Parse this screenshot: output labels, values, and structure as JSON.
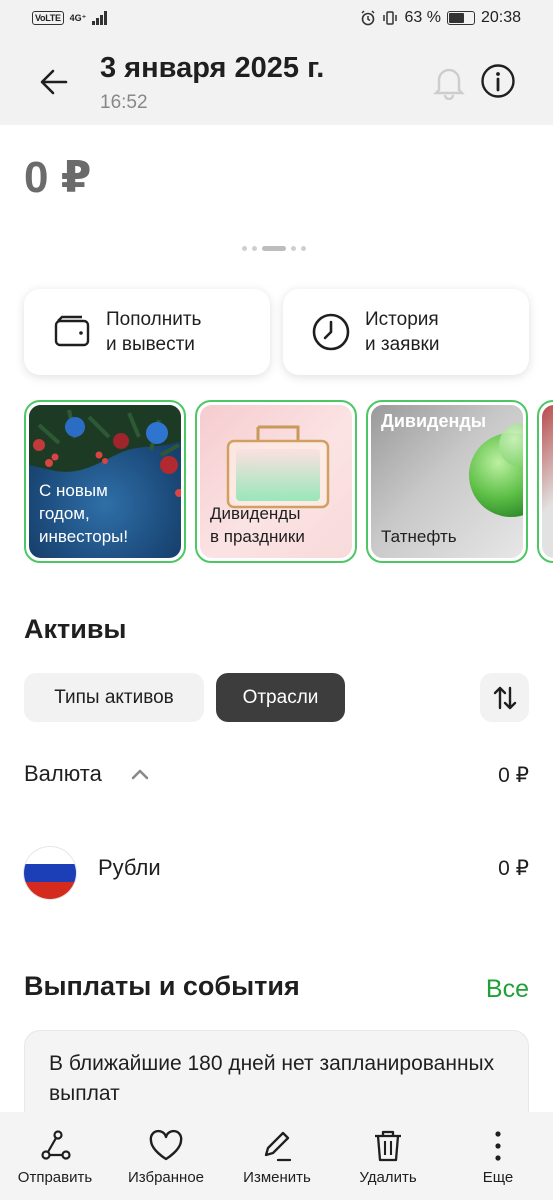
{
  "status_bar": {
    "volte": "VoLTE",
    "network": "4G⁺",
    "battery_percent": "63 %",
    "battery_level": 0.63,
    "time": "20:38"
  },
  "header": {
    "title": "3 января 2025 г.",
    "subtitle": "16:52"
  },
  "balance": "0 ₽",
  "actions": [
    {
      "label": "Пополнить\nи вывести",
      "icon": "wallet-icon"
    },
    {
      "label": "История\nи заявки",
      "icon": "clock-icon"
    }
  ],
  "stories": [
    {
      "caption": "С новым\nгодом,\nинвесторы!"
    },
    {
      "caption": "Дивиденды\nв праздники"
    },
    {
      "caption": "Татнефть",
      "heading": "Дивиденды"
    }
  ],
  "assets": {
    "title": "Активы",
    "chips": [
      "Типы активов",
      "Отрасли"
    ],
    "active_chip": "Отрасли",
    "group": {
      "label": "Валюта",
      "value": "0 ₽"
    },
    "items": [
      {
        "label": "Рубли",
        "value": "0 ₽",
        "icon": "russia-flag-icon"
      }
    ]
  },
  "payouts": {
    "title": "Выплаты и события",
    "all_link": "Все",
    "empty_text": "В ближайшие 180 дней нет запланированных выплат"
  },
  "bottom_bar": [
    {
      "label": "Отправить",
      "icon": "share-icon"
    },
    {
      "label": "Избранное",
      "icon": "heart-icon"
    },
    {
      "label": "Изменить",
      "icon": "pen-icon"
    },
    {
      "label": "Удалить",
      "icon": "trash-icon"
    },
    {
      "label": "Еще",
      "icon": "more-vertical-icon"
    }
  ],
  "colors": {
    "accent_green": "#21a038",
    "story_border": "#4cc764",
    "active_chip_bg": "#3d3d3d",
    "chip_bg": "#f2f2f2",
    "header_bg": "#f2f2f2"
  }
}
